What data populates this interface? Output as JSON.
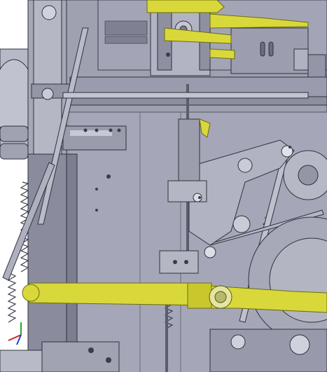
{
  "scene": {
    "kind": "cad-assembly-render",
    "colors": {
      "background": "#ffffff",
      "metal_light": "#a9abbb",
      "metal_mid": "#8b8d9e",
      "metal_dark": "#5d5f70",
      "edge": "#3c3e4c",
      "accent_yellow": "#d8d83a",
      "yellow_dark": "#9a9a1a"
    },
    "parts": [
      "frame-plate",
      "top-carriage",
      "yellow-rail-top",
      "yellow-link-bar",
      "left-column",
      "tie-rods",
      "bell-crank",
      "compression-springs",
      "drive-wheel",
      "sensor-bracket"
    ]
  }
}
